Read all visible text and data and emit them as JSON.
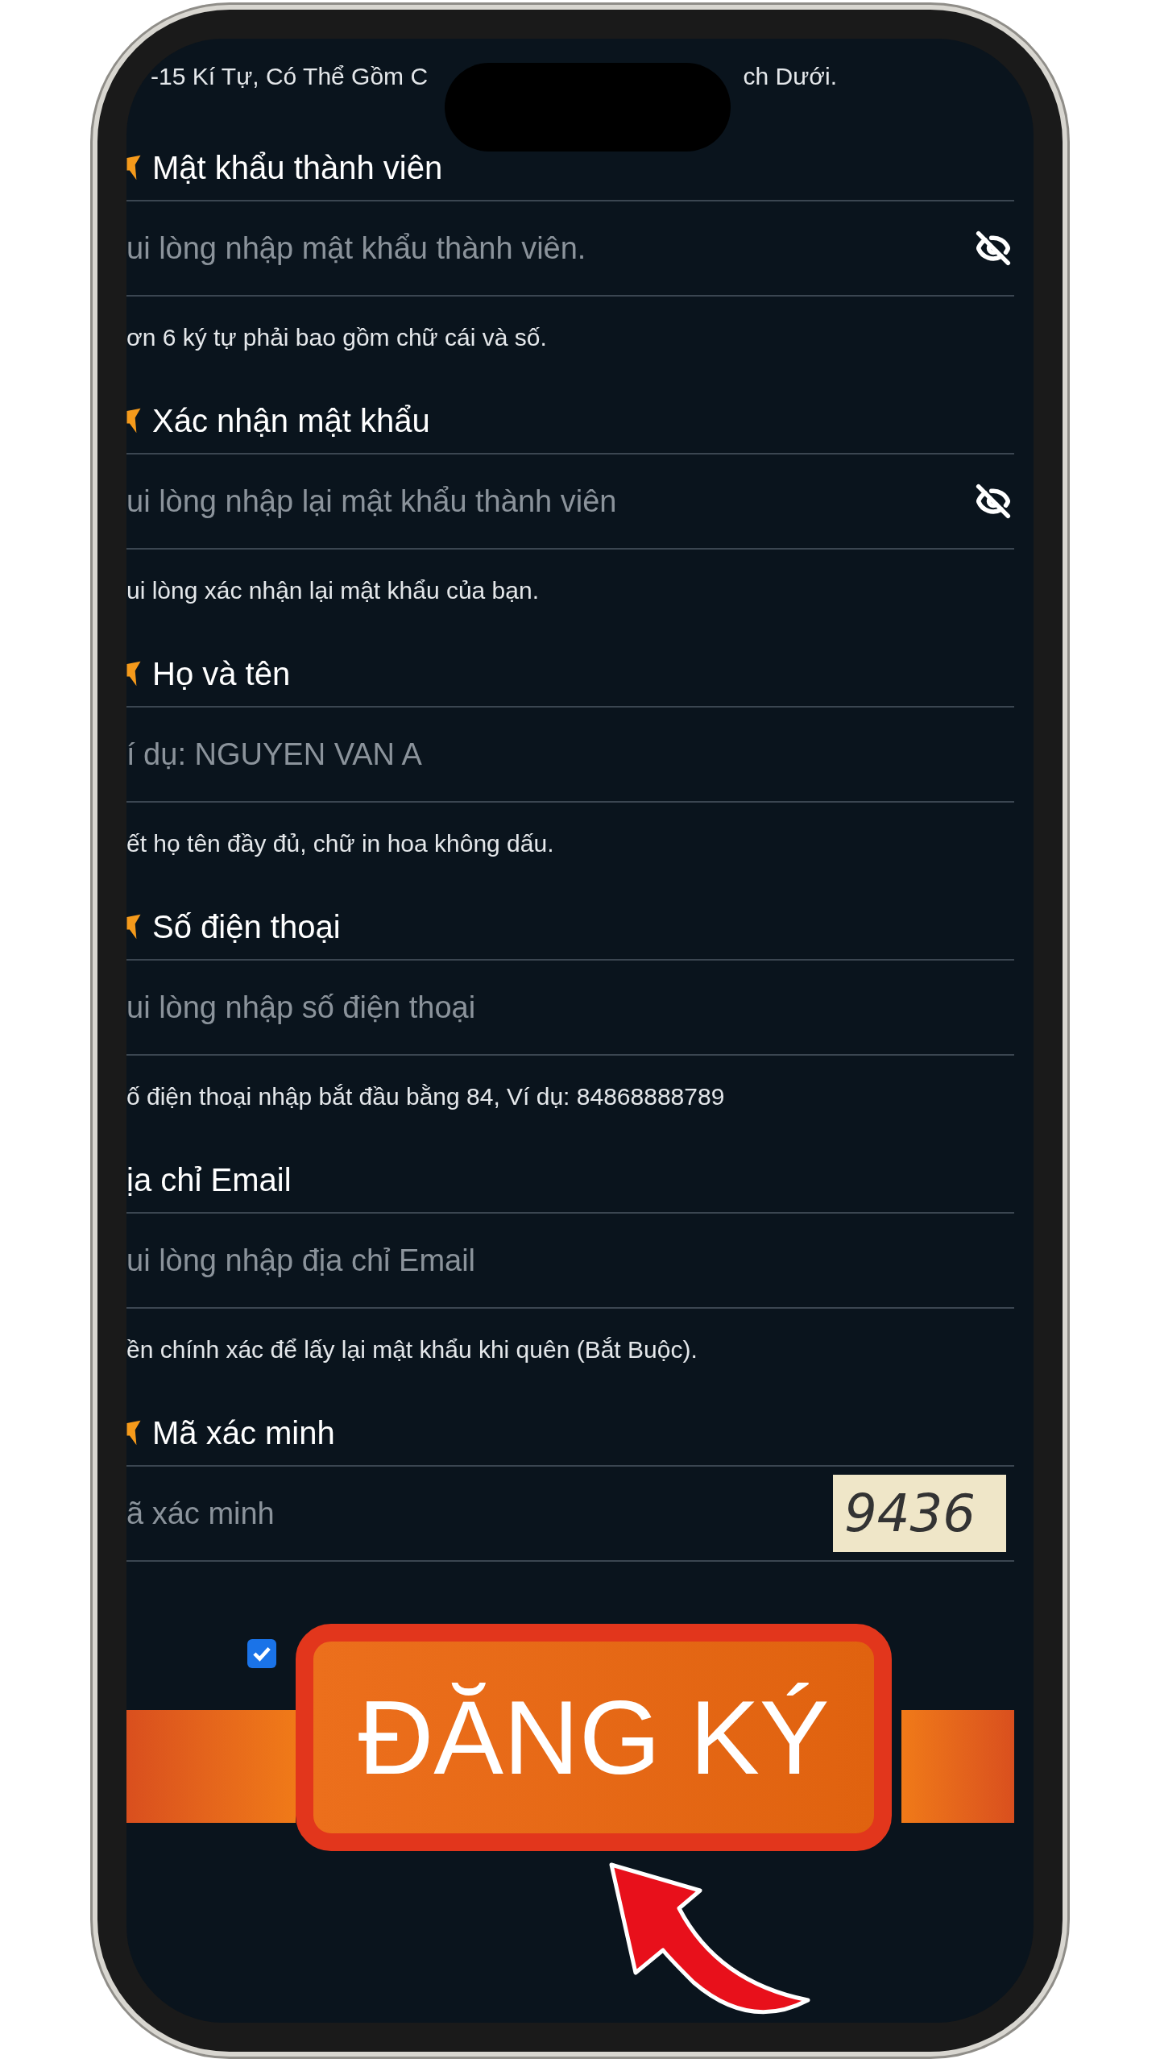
{
  "top_hint": {
    "before": "-15 Kí Tự, Có Thể Gồm C",
    "after": "ch Dưới."
  },
  "sections": [
    {
      "label": "Mật khẩu thành viên",
      "required": true,
      "placeholder": "ui lòng nhập mật khẩu thành viên.",
      "kind": "password",
      "hint": "ơn 6 ký tự phải bao gồm chữ cái và số."
    },
    {
      "label": "Xác nhận mật khẩu",
      "required": true,
      "placeholder": "ui lòng nhập lại mật khẩu thành viên",
      "kind": "password",
      "hint": "ui lòng xác nhận lại mật khẩu của bạn."
    },
    {
      "label": "Họ và tên",
      "required": true,
      "placeholder": "í dụ: NGUYEN VAN A",
      "kind": "text",
      "hint": "ết họ tên đầy đủ, chữ in hoa không dấu."
    },
    {
      "label": "Số điện thoại",
      "required": true,
      "placeholder": "ui lòng nhập số điện thoại",
      "kind": "text",
      "hint": "ố điện thoại nhập bắt đầu bằng 84, Ví dụ: 84868888789"
    },
    {
      "label": "ịa chỉ Email",
      "required": false,
      "placeholder": "ui lòng nhập địa chỉ Email",
      "kind": "text",
      "hint": "ền chính xác để lấy lại mật khẩu khi quên (Bắt Buộc)."
    },
    {
      "label": "Mã xác minh",
      "required": true,
      "placeholder": "ã xác minh",
      "kind": "captcha",
      "captcha": "9436"
    }
  ],
  "agreement": {
    "checked": true
  },
  "callout": {
    "label": "ĐĂNG KÝ"
  }
}
